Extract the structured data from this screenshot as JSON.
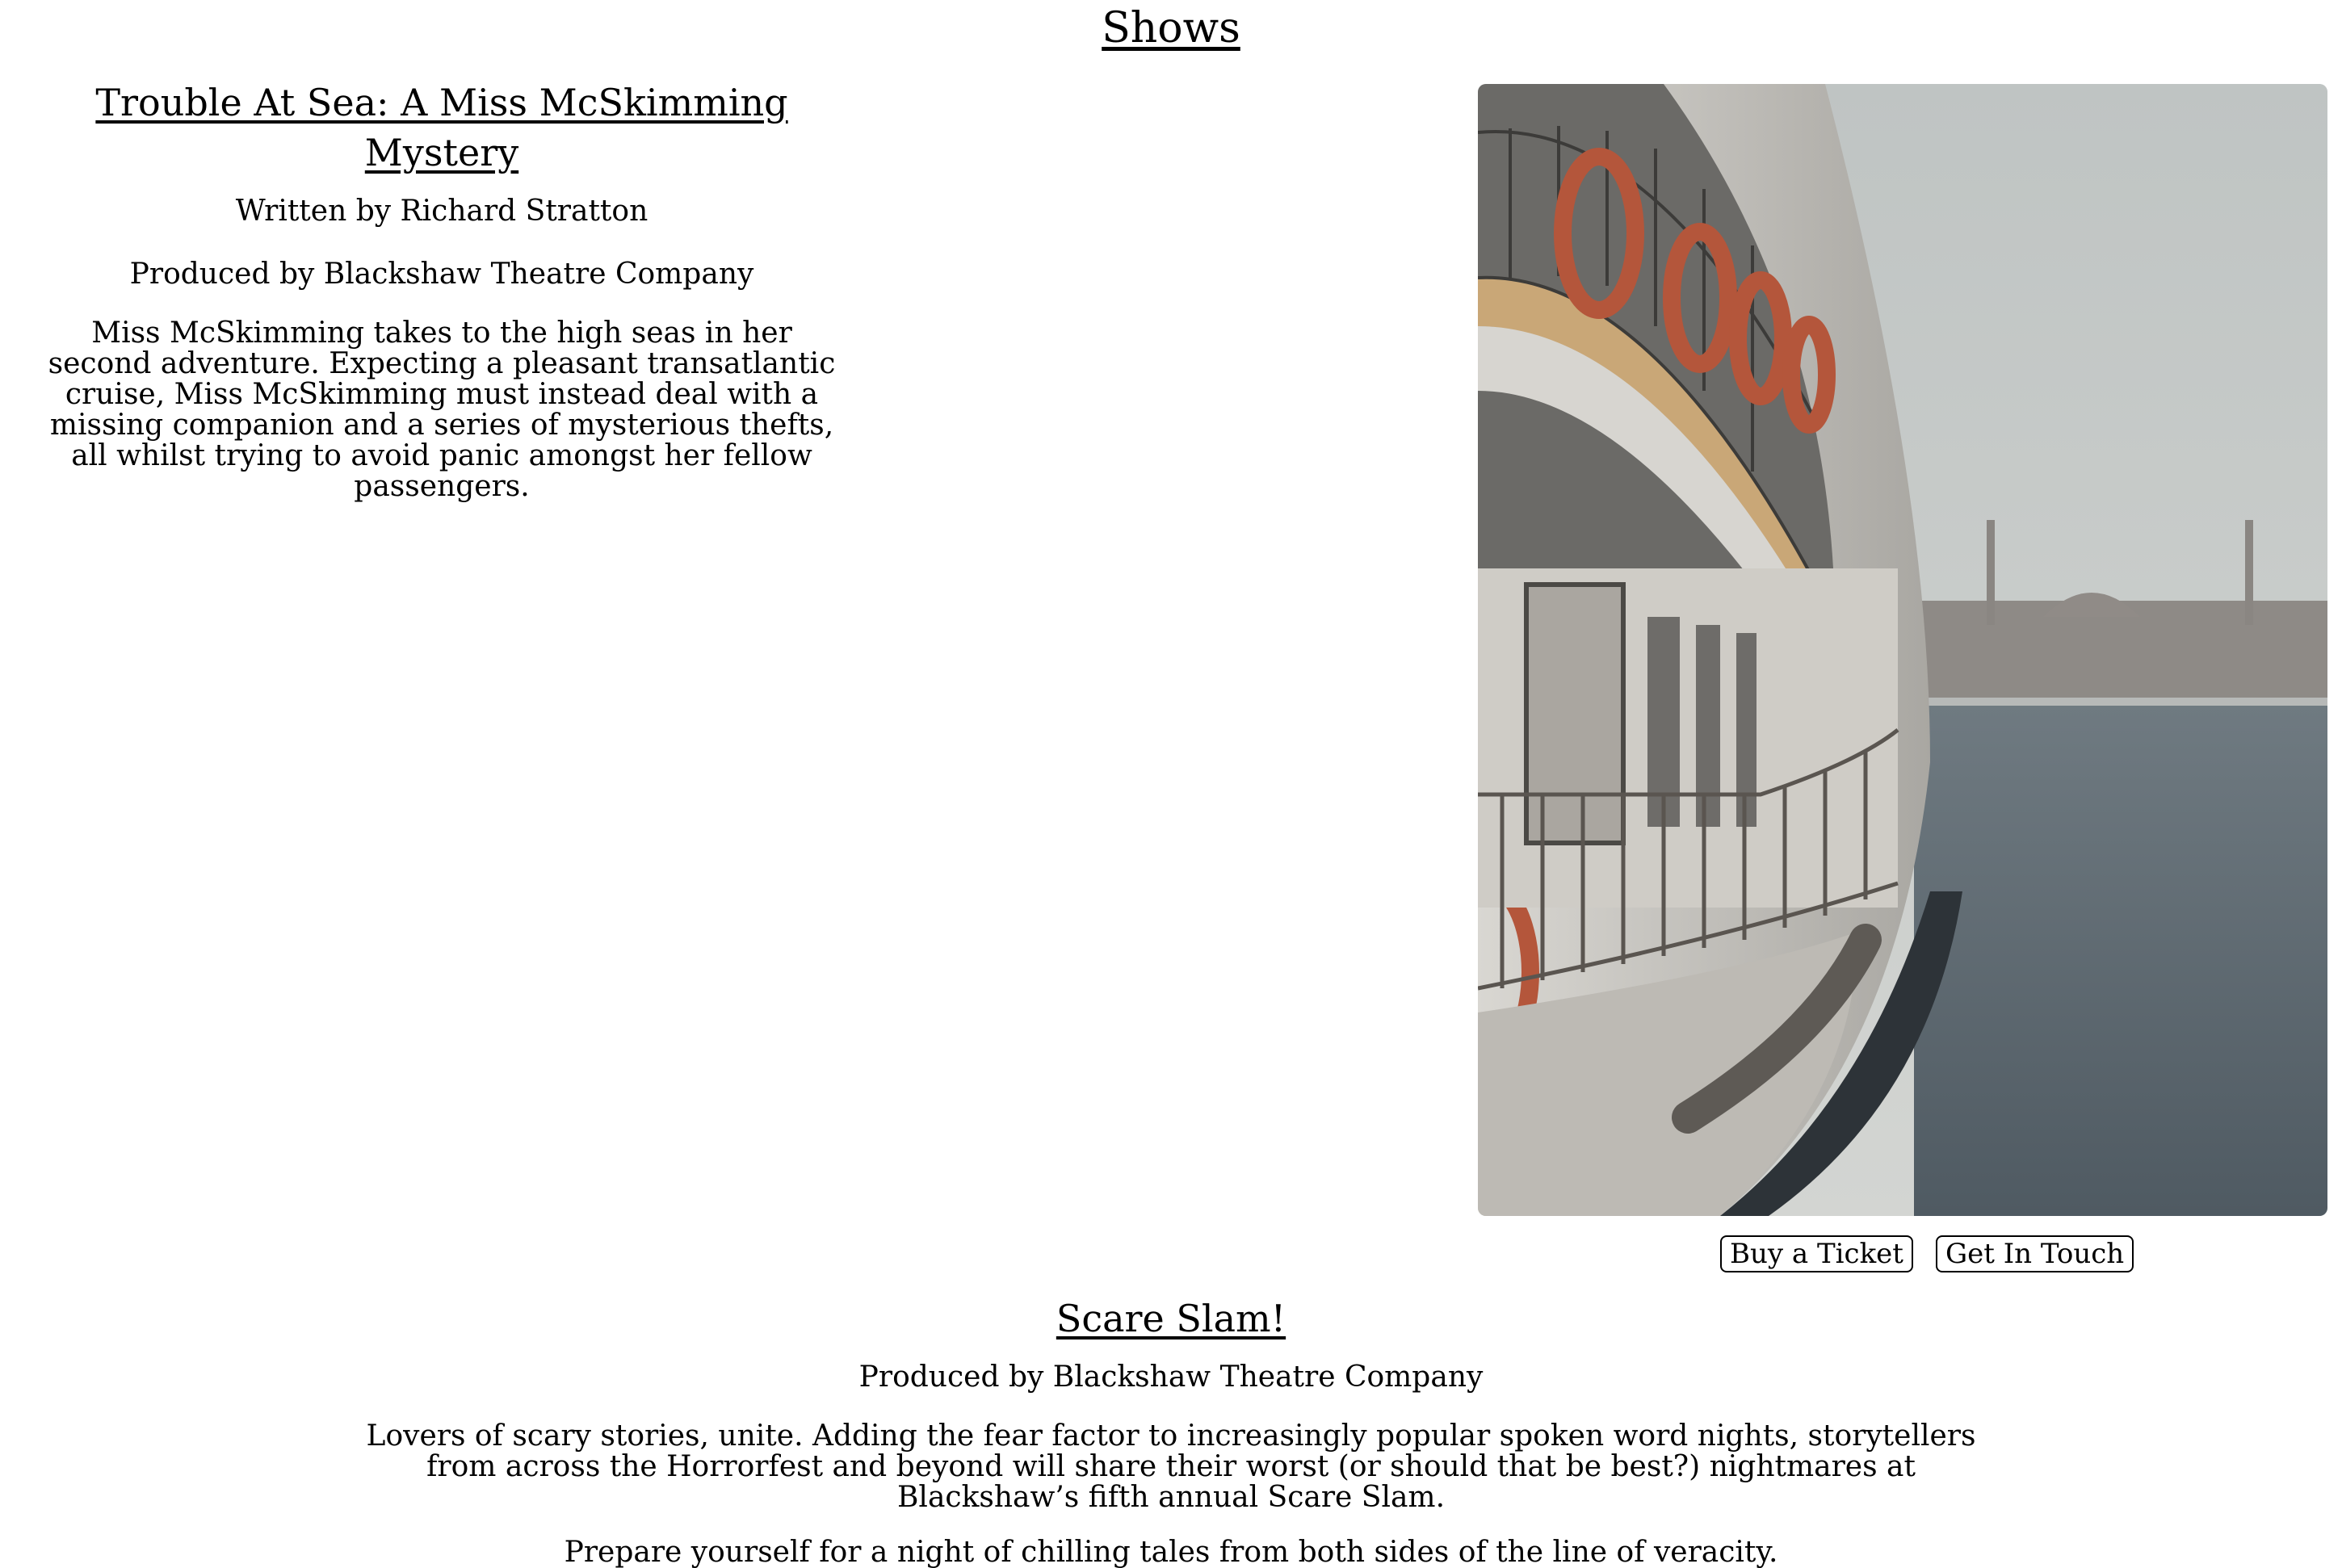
{
  "page": {
    "title": "Shows"
  },
  "shows": [
    {
      "title": "Trouble At Sea: A Miss McSkimming Mystery",
      "written_by": "Written by Richard Stratton",
      "produced_by": "Produced by Blackshaw Theatre Company",
      "description": "Miss McSkimming takes to the high seas in her second adventure. Expecting a pleasant transatlantic cruise, Miss McSkimming must instead deal with a missing companion and a series of mysterious thefts, all whilst trying to avoid panic amongst her fellow passengers.",
      "image_icon": "ferry-photo",
      "buttons": {
        "buy": "Buy a Ticket",
        "contact": "Get In Touch"
      }
    },
    {
      "title": "Scare Slam!",
      "produced_by": "Produced by Blackshaw Theatre Company",
      "description": "Lovers of scary stories, unite. Adding the fear factor to increasingly popular spoken word nights, storytellers from across the Horrorfest and beyond will share their worst (or should that be best?) nightmares at Blackshaw’s fifth annual Scare Slam.",
      "tagline": "Prepare yourself for a night of chilling tales from both sides of the line of veracity."
    }
  ]
}
